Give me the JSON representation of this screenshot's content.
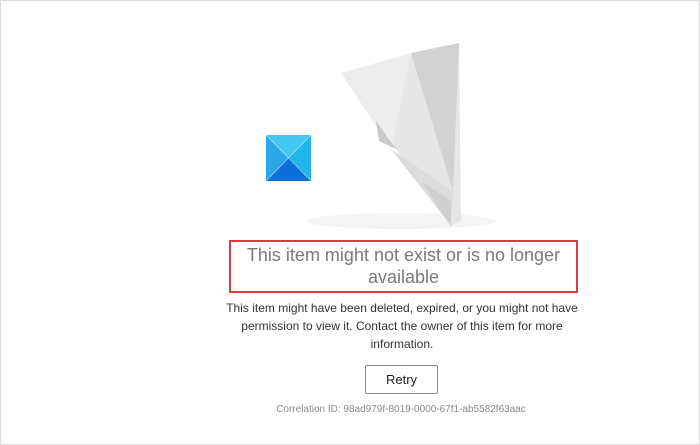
{
  "error": {
    "title": "This item might not exist or is no longer available",
    "description": "This item might have been deleted, expired, or you might not have permission to view it. Contact the owner of this item for more information.",
    "retry_label": "Retry",
    "correlation_id": "Correlation ID: 98ad979f-8019-0000-67f1-ab5582f63aac"
  },
  "illustration": {
    "icon_name": "paper-plane-illustration"
  },
  "logo": {
    "icon_name": "windows-logo-icon",
    "colors": [
      "#1fb6e8",
      "#0a6fd8",
      "#2aa7ea",
      "#0b5fcc"
    ]
  },
  "colors": {
    "highlight_border": "#e0383e",
    "title_text": "#7a7a7a",
    "muted_text": "#8a8a8a"
  }
}
